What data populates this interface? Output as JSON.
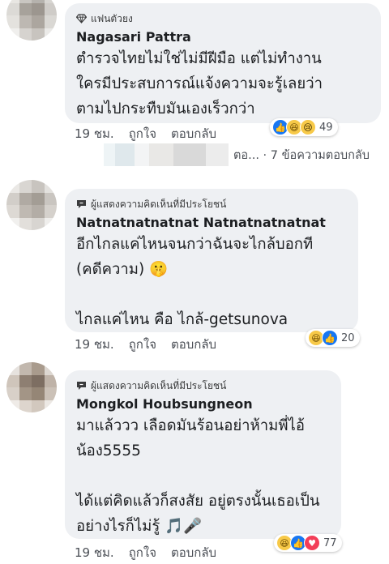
{
  "comments": [
    {
      "badge": "แฟนตัวยง",
      "author": "Nagasari Pattra",
      "text": "ตำรวจไทยไม่ใช่ไม่มีฝีมือ แต่ไม่ทำงาน\nใครมีประสบการณ์แจ้งความจะรู้เลยว่า\nตามไปกระทืบมันเองเร็วกว่า",
      "time": "19 ชม.",
      "like_label": "ถูกใจ",
      "reply_label": "ตอบกลับ",
      "reaction_count": "49",
      "reactions": [
        "like",
        "laugh",
        "sad"
      ]
    },
    {
      "badge": "ผู้แสดงความคิดเห็นที่มีประโยชน์",
      "author": "Natnatnatnatnat Natnatnatnatnat",
      "text": "อีกไกลแค่ไหนจนกว่าฉันจะไกล้บอกที\n(คดีความ) 🤫\n\nไกลแค่ไหน คือ ไกล้-getsunova",
      "time": "19 ชม.",
      "like_label": "ถูกใจ",
      "reply_label": "ตอบกลับ",
      "reaction_count": "20",
      "reactions": [
        "laugh",
        "like"
      ]
    },
    {
      "badge": "ผู้แสดงความคิดเห็นที่มีประโยชน์",
      "author": "Mongkol Houbsungneon",
      "text": "มาแล้ววว เลือดมันร้อนอย่าห้ามพี่ไอ้\nน้อง5555\n\nได้แต่คิดแล้วก็สงสัย อยู่ตรงนั้นเธอเป็น\nอย่างไรก็ไม่รู้ 🎵🎤",
      "time": "19 ชม.",
      "like_label": "ถูกใจ",
      "reply_label": "ตอบกลับ",
      "reaction_count": "77",
      "reactions": [
        "laugh",
        "like",
        "love"
      ]
    }
  ],
  "replies_summary": "ตอ... · 7 ข้อความตอบกลับ",
  "colors": {
    "bubble": "#eef0f3",
    "meta_text": "#4b4f56",
    "like_blue": "#1877f2",
    "haha_yellow": "#f7c948",
    "love_red": "#f33e58"
  }
}
